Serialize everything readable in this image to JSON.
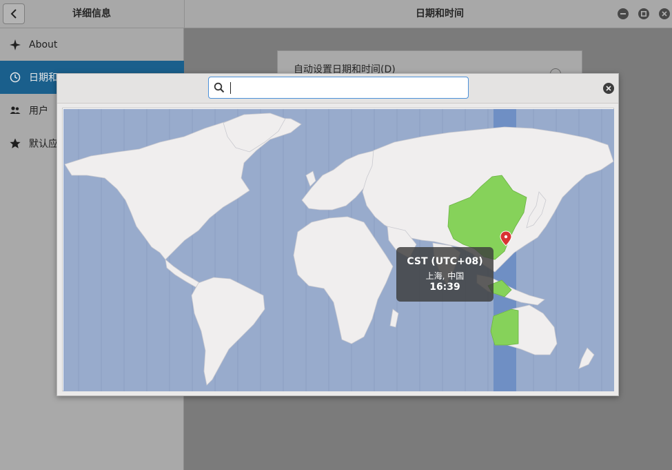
{
  "header": {
    "left_title": "详细信息",
    "main_title": "日期和时间"
  },
  "sidebar": {
    "items": [
      {
        "label": "About",
        "icon": "sparkle-icon"
      },
      {
        "label": "日期和",
        "icon": "clock-icon",
        "active": true
      },
      {
        "label": "用户",
        "icon": "users-icon"
      },
      {
        "label": "默认应",
        "icon": "star-icon"
      }
    ]
  },
  "main": {
    "auto_datetime_label": "自动设置日期和时间(D)"
  },
  "dialog": {
    "search": {
      "value": "",
      "placeholder": ""
    },
    "tooltip": {
      "timezone": "CST (UTC+08)",
      "city": "上海, 中国",
      "time": "16:39"
    }
  },
  "colors": {
    "selection": "#1a5f8c",
    "ocean": "#98abcc",
    "land": "#f0eeee",
    "highlight_zone": "#6f8fc4",
    "highlight_land": "#86d25a",
    "pin": "#d83333"
  }
}
